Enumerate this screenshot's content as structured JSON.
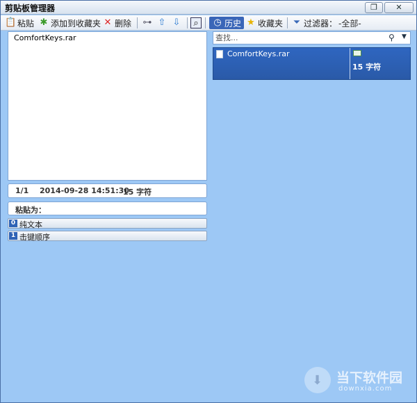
{
  "window": {
    "title": "剪贴板管理器",
    "restore_icon": "restore-icon",
    "close_glyph": "✕"
  },
  "toolbar": {
    "paste": "粘贴",
    "add_favorite": "添加到收藏夹",
    "delete": "删除",
    "history": "历史",
    "favorites": "收藏夹",
    "filter_label": "过滤器：",
    "filter_value": "-全部-"
  },
  "content": {
    "text": "ComfortKeys.rar"
  },
  "info": {
    "position": "1/1",
    "timestamp": "2014-09-28 14:51:30",
    "size": "15 字符"
  },
  "paste_as": {
    "label": "粘贴为：",
    "options": [
      {
        "num": "0",
        "label": "纯文本"
      },
      {
        "num": "1",
        "label": "击键顺序"
      }
    ]
  },
  "search": {
    "placeholder": "查找..."
  },
  "entries": [
    {
      "name": "ComfortKeys.rar",
      "size": "15 字符"
    }
  ],
  "watermark": {
    "title": "当下软件园",
    "url": "downxia.com"
  }
}
